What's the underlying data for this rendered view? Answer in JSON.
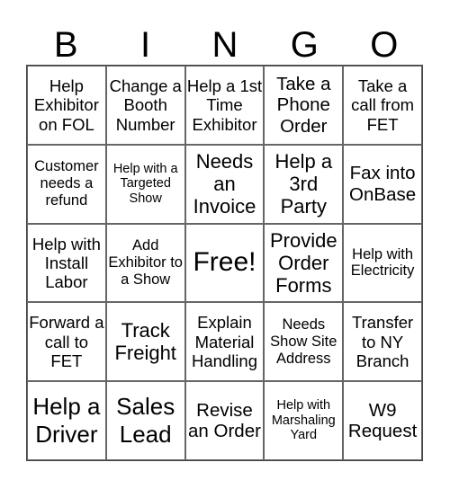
{
  "header": {
    "letters": [
      "B",
      "I",
      "N",
      "G",
      "O"
    ]
  },
  "cells": [
    "Help Exhibitor on FOL",
    "Change a Booth Number",
    "Help a 1st Time Exhibitor",
    "Take a Phone Order",
    "Take a call from FET",
    "Customer needs a refund",
    "Help with a Targeted Show",
    "Needs an Invoice",
    "Help a 3rd Party",
    "Fax into OnBase",
    "Help with Install Labor",
    "Add Exhibitor to a Show",
    "Free!",
    "Provide Order Forms",
    "Help with Electricity",
    "Forward a call to FET",
    "Track Freight",
    "Explain Material Handling",
    "Needs Show Site Address",
    "Transfer to NY Branch",
    "Help a Driver",
    "Sales Lead",
    "Revise an Order",
    "Help with Marshaling Yard",
    "W9 Request"
  ]
}
